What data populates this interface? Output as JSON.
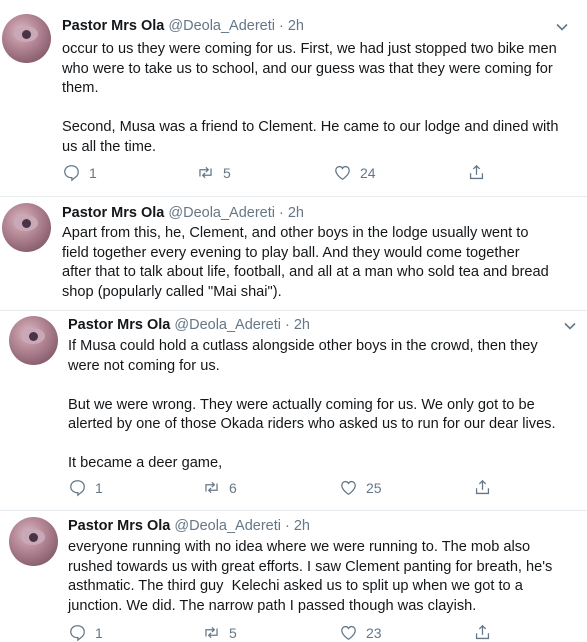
{
  "tweets": [
    {
      "name": "Pastor Mrs Ola",
      "handle": "@Deola_Adereti · 2h",
      "text": "occur to us they were coming for us. First, we had just stopped two bike men\nwho were to take us to school, and our guess was that they were coming for\nthem.\n\nSecond, Musa was a friend to Clement. He came to our lodge and dined with\nus all the time.",
      "replies": "1",
      "retweets": "5",
      "likes": "24"
    },
    {
      "name": "Pastor Mrs Ola",
      "handle": "@Deola_Adereti · 2h",
      "text": "Apart from this, he, Clement, and other boys in the lodge usually went to\nfield together every evening to play ball. And they would come together\nafter that to talk about life, football, and all at a man who sold tea and bread\nshop (popularly called \"Mai shai\")."
    },
    {
      "name": "Pastor Mrs Ola",
      "handle": "@Deola_Adereti · 2h",
      "text": "If Musa could hold a cutlass alongside other boys in the crowd, then they\nwere not coming for us.\n\nBut we were wrong. They were actually coming for us. We only got to be\nalerted by one of those Okada riders who asked us to run for our dear lives.\n\nIt became a deer game,",
      "replies": "1",
      "retweets": "6",
      "likes": "25"
    },
    {
      "name": "Pastor Mrs Ola",
      "handle": "@Deola_Adereti · 2h",
      "text": "everyone running with no idea where we were running to. The mob also\nrushed towards us with great efforts. I saw Clement panting for breath, he's\nasthmatic. The third guy  Kelechi asked us to split up when we got to a\njunction. We did. The narrow path I passed though was clayish.",
      "replies": "1",
      "retweets": "5",
      "likes": "23"
    }
  ],
  "icons": [
    "reply-icon",
    "retweet-icon",
    "like-icon",
    "share-icon",
    "chevron-down-icon"
  ],
  "colors": {
    "text": "#14171a",
    "secondary": "#657786",
    "border": "#e6ecf0"
  }
}
